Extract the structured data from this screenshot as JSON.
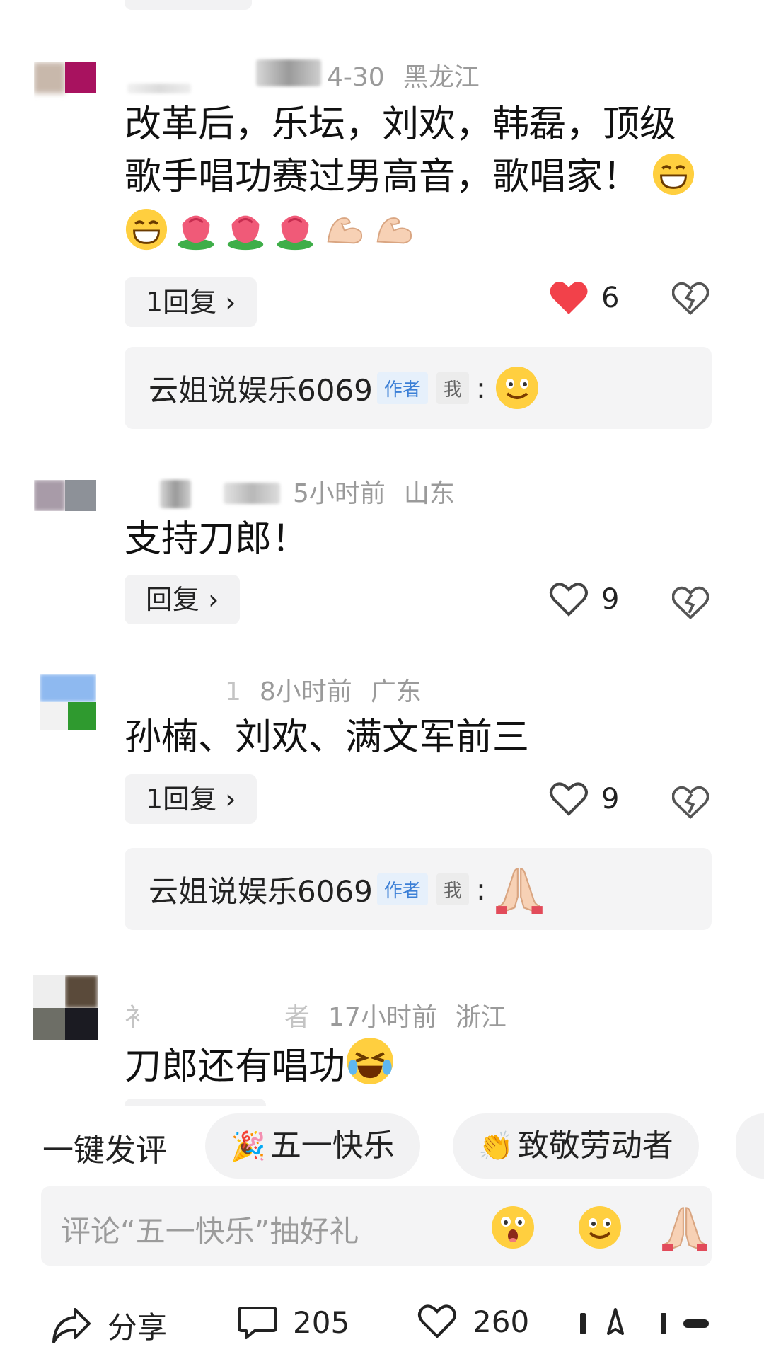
{
  "comments": [
    {
      "date": "4-30",
      "location": "黑龙江",
      "text_line1": "改革后，乐坛，刘欢，韩磊，顶级",
      "text_line2": "歌手唱功赛过男高音，歌唱家！",
      "reply_label": "1回复 ›",
      "likes": "6",
      "liked": true,
      "sub_reply": {
        "author": "云姐说娱乐6069",
        "author_tag": "作者",
        "me_tag": "我",
        "colon": ":"
      }
    },
    {
      "date": "5小时前",
      "location": "山东",
      "text_line1": "支持刀郎！",
      "reply_label": "回复 ›",
      "likes": "9",
      "liked": false
    },
    {
      "name_fragment": "1",
      "date": "8小时前",
      "location": "广东",
      "text_line1": "孙楠、刘欢、满文军前三",
      "reply_label": "1回复 ›",
      "likes": "9",
      "liked": false,
      "sub_reply": {
        "author": "云姐说娱乐6069",
        "author_tag": "作者",
        "me_tag": "我",
        "colon": ":"
      }
    },
    {
      "name_fragment_start": "衤",
      "name_fragment_end": "者",
      "date": "17小时前",
      "location": "浙江",
      "text_line1": "刀郎还有唱功"
    }
  ],
  "quick_comment": {
    "label": "一键发评",
    "chips": [
      "五一快乐",
      "致敬劳动者"
    ]
  },
  "input": {
    "placeholder": "评论“五一快乐”抽好礼"
  },
  "bottom_bar": {
    "share_label": "分享",
    "comments_count": "205",
    "likes_count": "260"
  },
  "colors": {
    "like_red": "#f2414a",
    "chip_bg": "#f2f2f3",
    "author_tag": "#3b7fd6"
  }
}
